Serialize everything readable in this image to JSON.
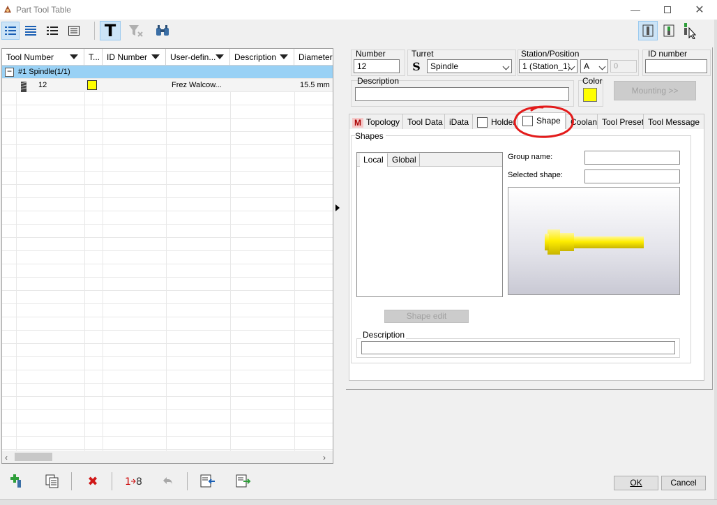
{
  "window": {
    "title": "Part Tool Table"
  },
  "grid": {
    "columns": [
      "Tool Number",
      "T...",
      "ID Number",
      "User-defin...",
      "Description",
      "Diameter"
    ],
    "spindle_row": "#1 Spindle(1/1)",
    "tool_row": {
      "number": "12",
      "user_defined": "Frez Walcow...",
      "diameter": "15.5 mm",
      "color": "#ffff00"
    }
  },
  "form": {
    "number_label": "Number",
    "number_value": "12",
    "turret_label": "Turret",
    "turret_value": "Spindle",
    "station_label": "Station/Position",
    "station_value": "1 (Station_1)",
    "position_value": "A",
    "position_num": "0",
    "id_label": "ID number",
    "id_value": "",
    "description_label": "Description",
    "description_value": "",
    "color_label": "Color",
    "color_value": "#ffff00",
    "mounting_label": "Mounting >>"
  },
  "tabs": [
    "Topology",
    "Tool Data",
    "iData",
    "Holder",
    "Shape",
    "Coolant",
    "Tool Preset",
    "Tool Message"
  ],
  "selected_tab": "Shape",
  "shape_panel": {
    "group_title": "Shapes",
    "subtabs": [
      "Local",
      "Global"
    ],
    "group_name_label": "Group name:",
    "group_name_value": "",
    "selected_shape_label": "Selected shape:",
    "selected_shape_value": "",
    "shape_edit_label": "Shape edit",
    "description_label": "Description",
    "description_value": "",
    "tool_color": "#ffee00"
  },
  "buttons": {
    "ok": "OK",
    "cancel": "Cancel"
  },
  "annotation": {
    "color": "#e31b1b"
  }
}
